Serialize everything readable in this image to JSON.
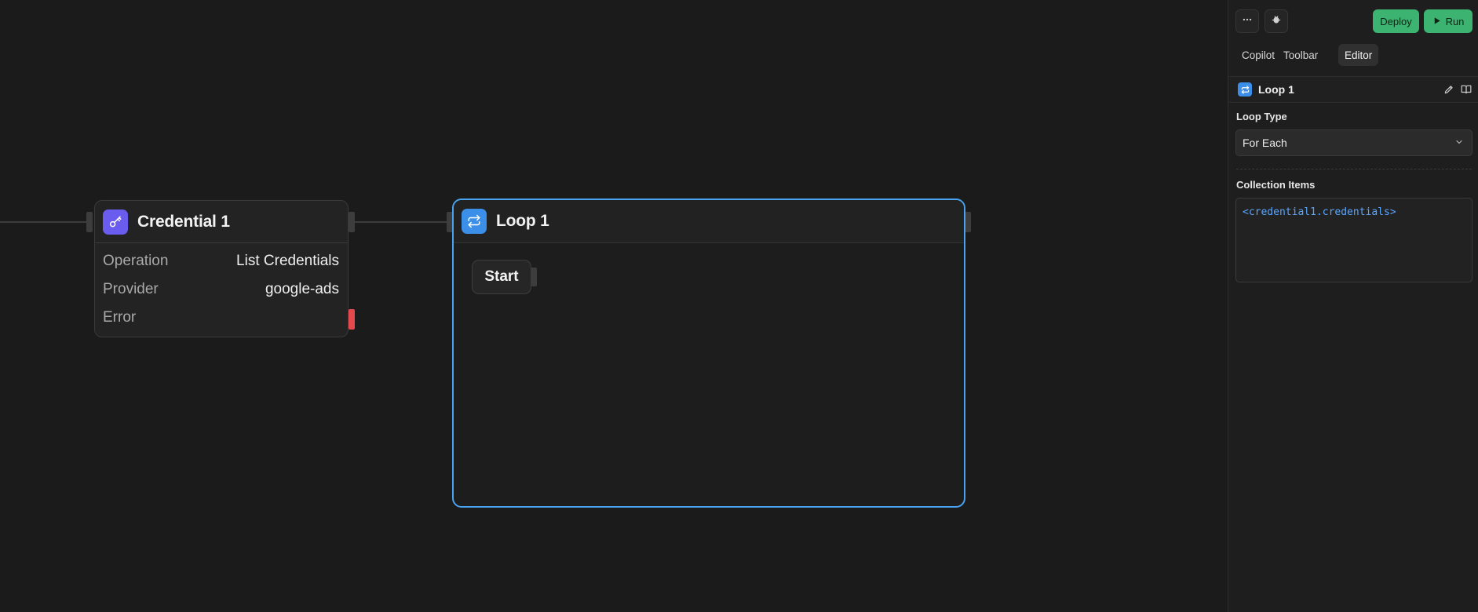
{
  "canvas": {
    "credential_node": {
      "title": "Credential 1",
      "icon": "key-icon",
      "icon_color": "#6b5cf0",
      "rows": [
        {
          "key": "Operation",
          "value": "List Credentials"
        },
        {
          "key": "Provider",
          "value": "google-ads"
        },
        {
          "key": "Error",
          "value": ""
        }
      ]
    },
    "loop_node": {
      "title": "Loop 1",
      "icon": "loop-arrows-icon",
      "icon_color": "#3b8fe8",
      "border_color": "#4aa3f0",
      "start_label": "Start"
    }
  },
  "panel": {
    "more_icon": "more-horizontal-icon",
    "debug_icon": "bug-icon",
    "deploy_label": "Deploy",
    "run_label": "Run",
    "run_icon": "play-icon",
    "accent_color": "#3cb371",
    "tabs": [
      {
        "label": "Copilot",
        "active": false
      },
      {
        "label": "Toolbar",
        "active": false
      },
      {
        "label": "Editor",
        "active": true
      }
    ],
    "editor": {
      "title": "Loop 1",
      "edit_icon": "pencil-icon",
      "docs_icon": "book-icon",
      "loop_type_label": "Loop Type",
      "loop_type_value": "For Each",
      "collection_label": "Collection Items",
      "collection_value": "<credential1.credentials>"
    }
  }
}
